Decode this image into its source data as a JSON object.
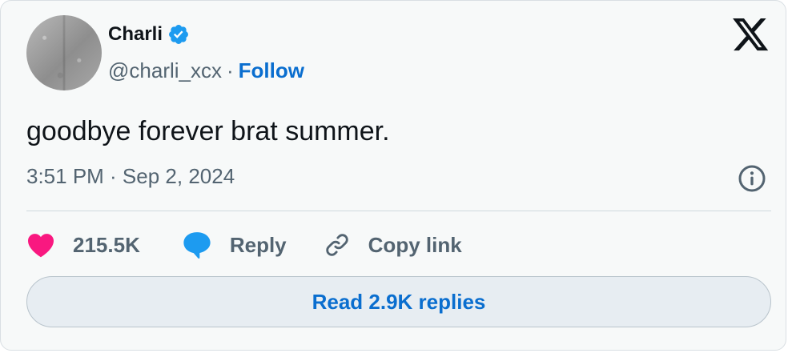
{
  "author": {
    "name": "Charli",
    "handle": "@charli_xcx",
    "separator": "·",
    "follow_label": "Follow",
    "verified": true
  },
  "tweet": {
    "text": "goodbye forever brat summer.",
    "timestamp": "3:51 PM · Sep 2, 2024"
  },
  "actions": {
    "likes_count": "215.5K",
    "reply_label": "Reply",
    "copy_link_label": "Copy link"
  },
  "read_replies_label": "Read 2.9K replies",
  "icons": {
    "verified": "verified-badge-icon",
    "platform": "x-logo-icon",
    "info": "info-icon",
    "like": "heart-icon",
    "reply": "speech-bubble-icon",
    "link": "link-icon"
  },
  "colors": {
    "accent": "#0a6ecf",
    "verified": "#1d9bf0",
    "like": "#f91880",
    "text": "#0f1419",
    "muted": "#536471"
  }
}
